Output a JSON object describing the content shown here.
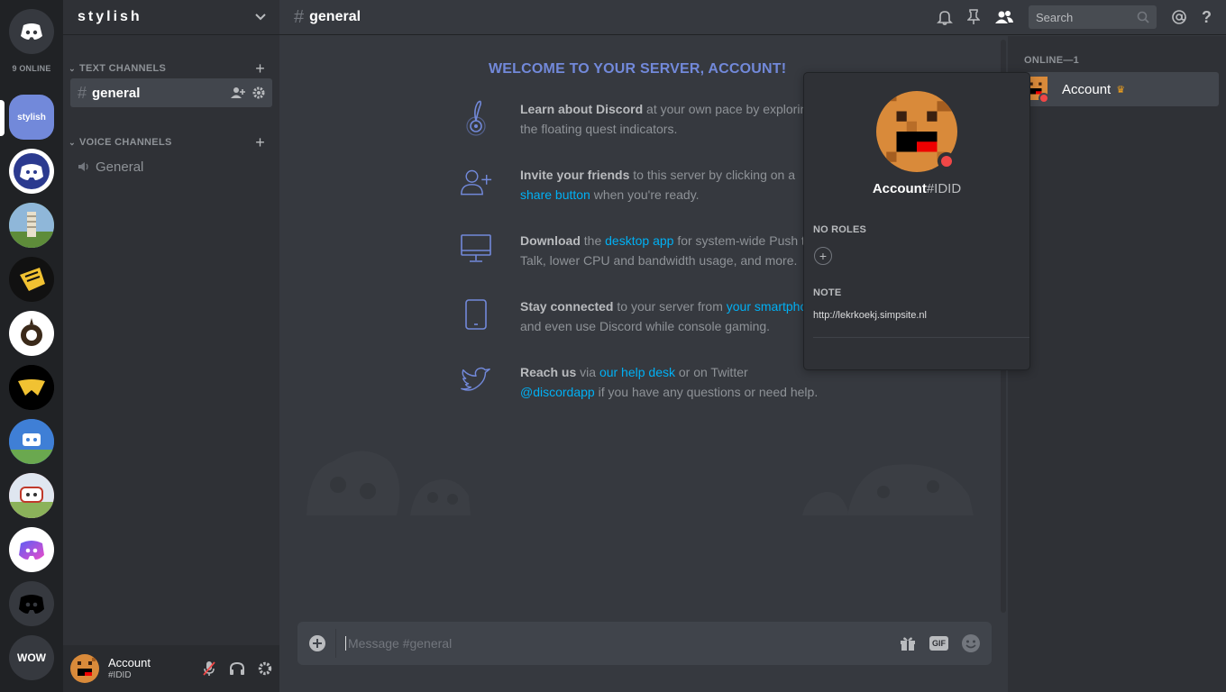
{
  "rail": {
    "online_label": "9 ONLINE",
    "servers": [
      {
        "label": "stylish"
      },
      {
        "label": ""
      },
      {
        "label": ""
      },
      {
        "label": ""
      },
      {
        "label": ""
      },
      {
        "label": ""
      },
      {
        "label": ""
      },
      {
        "label": ""
      },
      {
        "label": ""
      },
      {
        "label": ""
      },
      {
        "label": "WOW"
      }
    ]
  },
  "guild": {
    "name": "stylish",
    "text_category": "TEXT CHANNELS",
    "voice_category": "VOICE CHANNELS",
    "text_channels": [
      {
        "name": "general"
      }
    ],
    "voice_channels": [
      {
        "name": "General"
      }
    ]
  },
  "userbar": {
    "name": "Account",
    "tag": "#IDID"
  },
  "header": {
    "channel": "general",
    "search_placeholder": "Search"
  },
  "welcome": {
    "title": "WELCOME TO YOUR SERVER, ACCOUNT!",
    "rows": [
      {
        "icon": "quest-icon",
        "bold": "Learn about Discord",
        "t1": " at your own pace by exploring",
        "link": "",
        "t2": "the floating quest indicators.",
        "link2": "",
        "t3": ""
      },
      {
        "icon": "add-friend-icon",
        "bold": "Invite your friends",
        "t1": " to this server by clicking on a",
        "link": "",
        "t2": "",
        "link2": "share button",
        "t3": " when you're ready."
      },
      {
        "icon": "desktop-icon",
        "bold": "Download",
        "t1": " the ",
        "link": "desktop app",
        "t2": " for system-wide Push to",
        "link2": "",
        "t3": "Talk, lower CPU and bandwidth usage, and more."
      },
      {
        "icon": "phone-icon",
        "bold": "Stay connected",
        "t1": " to your server from ",
        "link": "your smartphone",
        "t2": "",
        "link2": "",
        "t3": "and even use Discord while console gaming."
      },
      {
        "icon": "twitter-icon",
        "bold": "Reach us",
        "t1": " via ",
        "link": "our help desk",
        "t2": " or on Twitter",
        "link2": "@discordapp",
        "t3": " if you have any questions or need help."
      }
    ]
  },
  "composer": {
    "placeholder": "Message #general"
  },
  "members": {
    "group": "ONLINE—1",
    "list": [
      {
        "name": "Account"
      }
    ]
  },
  "popout": {
    "name": "Account",
    "tag": "#IDID",
    "roles_label": "NO ROLES",
    "note_label": "NOTE",
    "note": "http://lekrkoekj.simpsite.nl"
  },
  "colors": {
    "accent": "#7289da",
    "link": "#00b0f4",
    "dnd": "#f04747",
    "crown": "#faa61a"
  }
}
